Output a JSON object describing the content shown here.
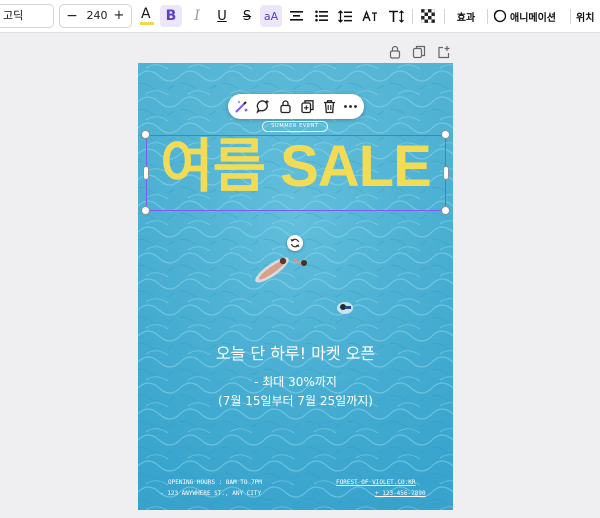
{
  "toolbar": {
    "font_name": "고딕",
    "font_size": "240",
    "decrease_label": "−",
    "increase_label": "+",
    "text_color_glyph": "A",
    "bold_glyph": "B",
    "italic_glyph": "I",
    "underline_glyph": "U",
    "strike_glyph": "S",
    "case_glyph": "aA",
    "effects_label": "효과",
    "animation_label": "애니메이션",
    "position_label": "위치",
    "text_color": "#f2d74e"
  },
  "poster": {
    "badge": "SUMMER EVENT",
    "title": "여름 SALE",
    "tagline": "오늘 단 하루! 마켓 오픈",
    "discount": "- 최대 30%까지",
    "dates": "(7월 15일부터 7월 25일까지)",
    "hours": "OPENING HOURS : 8AM TO 7PM",
    "address": "- 123 ANYWHERE ST., ANY CITY",
    "website": "FOREST OF VIOLET.CO.KR",
    "phone": "+ 123-456-7890",
    "title_color": "#f2dc55",
    "selection_color": "#7d5cf5"
  }
}
